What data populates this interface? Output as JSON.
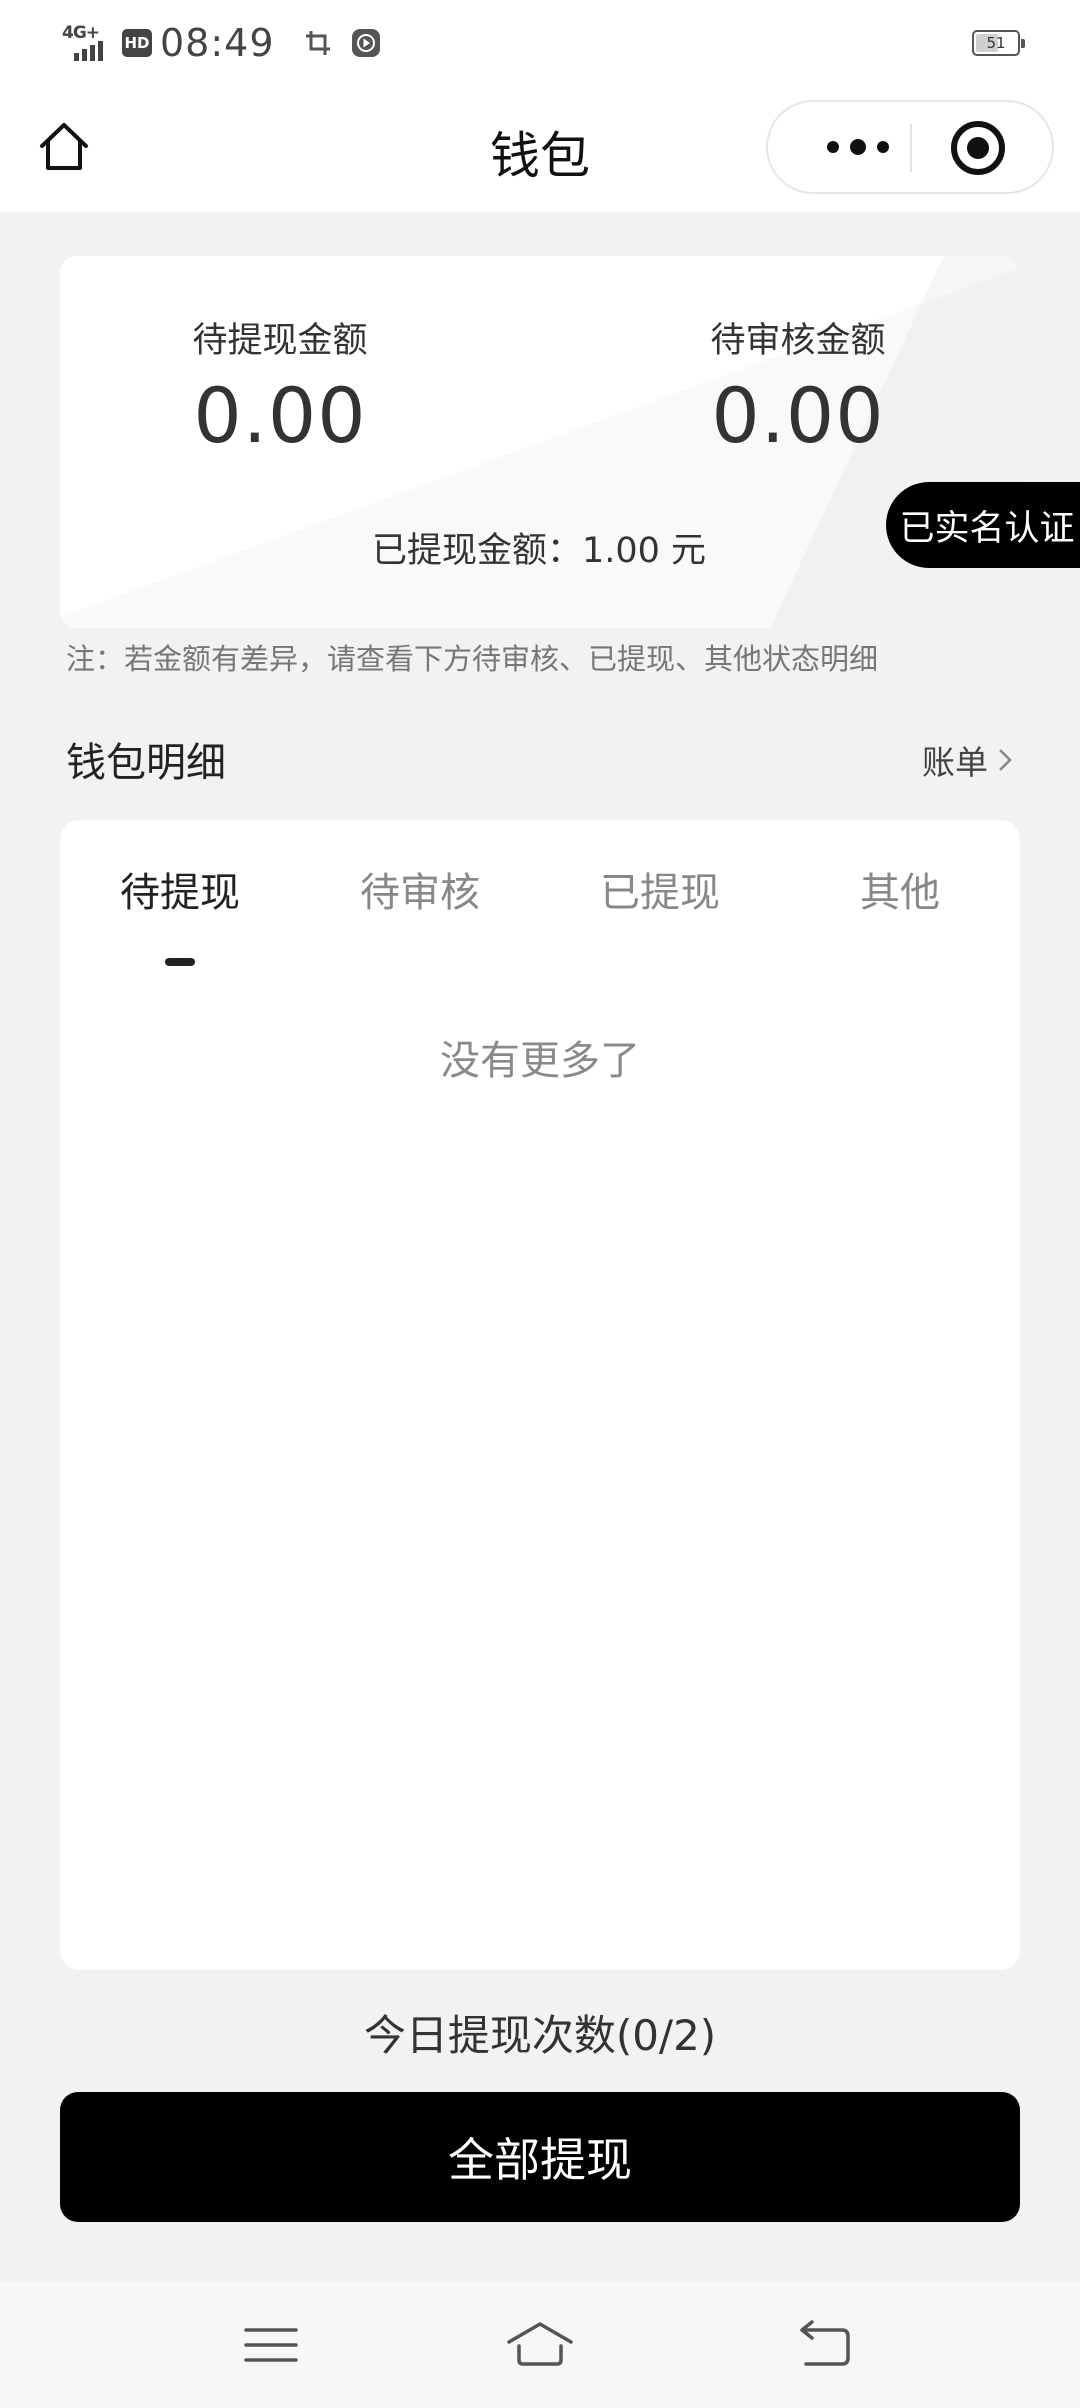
{
  "status_bar": {
    "network": "4G+",
    "hd": "HD",
    "time": "08:49",
    "battery": "51",
    "battery_level_percent": 51
  },
  "nav": {
    "title": "钱包"
  },
  "summary": {
    "pending_withdraw_label": "待提现金额",
    "pending_withdraw_value": "0.00",
    "pending_review_label": "待审核金额",
    "pending_review_value": "0.00",
    "withdrawn_text": "已提现金额：1.00 元"
  },
  "verified_badge": "已实名认证",
  "note": "注：若金额有差异，请查看下方待审核、已提现、其他状态明细",
  "details": {
    "title": "钱包明细",
    "bill_link": "账单",
    "tabs": [
      {
        "label": "待提现",
        "active": true
      },
      {
        "label": "待审核",
        "active": false
      },
      {
        "label": "已提现",
        "active": false
      },
      {
        "label": "其他",
        "active": false
      }
    ],
    "empty_text": "没有更多了"
  },
  "today_count": "今日提现次数(0/2)",
  "withdraw_all_button": "全部提现",
  "icons": {
    "home": "home-icon",
    "more": "more-dots-icon",
    "close": "target-circle-icon",
    "chevron": "chevron-right-icon",
    "sys_menu": "menu-lines-icon",
    "sys_home": "home-outline-icon",
    "sys_back": "back-arrow-icon"
  }
}
